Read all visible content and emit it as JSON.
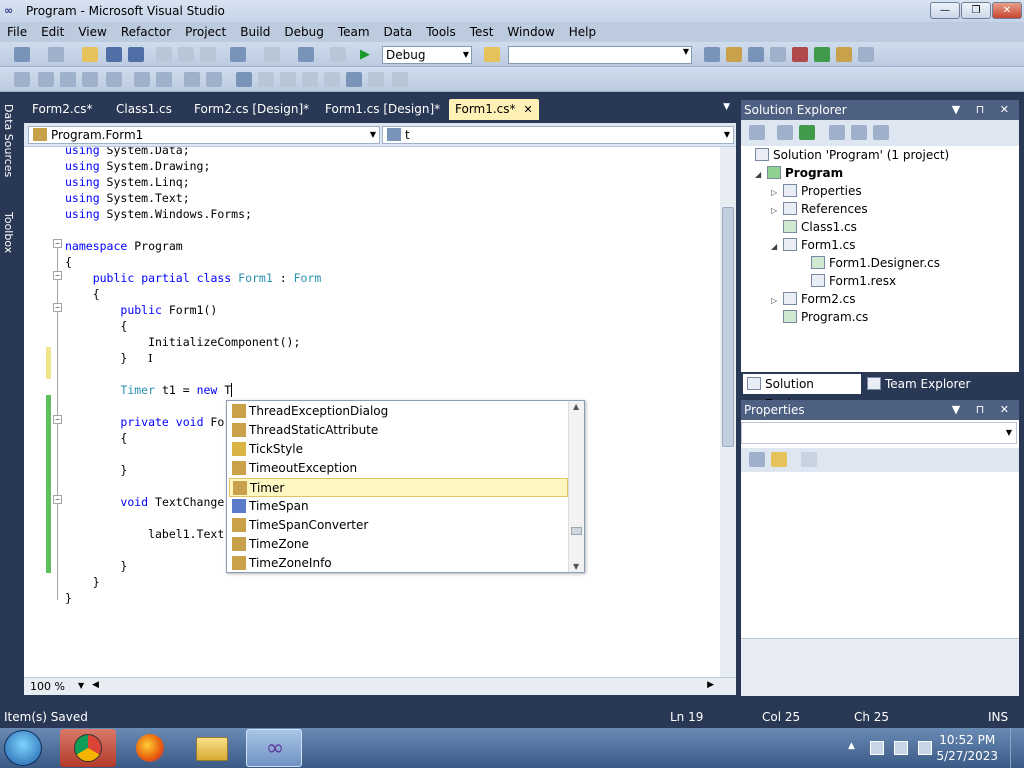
{
  "window": {
    "title": "Program - Microsoft Visual Studio",
    "min": "0",
    "max": "1",
    "close": "r"
  },
  "menu": [
    "File",
    "Edit",
    "View",
    "Refactor",
    "Project",
    "Build",
    "Debug",
    "Team",
    "Data",
    "Tools",
    "Test",
    "Window",
    "Help"
  ],
  "toolbar": {
    "configuration": "Debug",
    "platform": ""
  },
  "side_tabs": [
    "Data Sources",
    "Toolbox"
  ],
  "doc_tabs": [
    {
      "label": "Form2.cs*"
    },
    {
      "label": "Class1.cs"
    },
    {
      "label": "Form2.cs [Design]*"
    },
    {
      "label": "Form1.cs [Design]*"
    },
    {
      "label": "Form1.cs*",
      "active": true
    }
  ],
  "nav": {
    "type_selector": "Program.Form1",
    "member_selector": "t"
  },
  "code": {
    "lines": [
      "using System.Data;",
      "using System.Drawing;",
      "using System.Linq;",
      "using System.Text;",
      "using System.Windows.Forms;",
      "",
      "namespace Program",
      "{",
      "    public partial class Form1 : Form",
      "    {",
      "        public Form1()",
      "        {",
      "            InitializeComponent();",
      "        }",
      "",
      "        Timer t1 = new T",
      "",
      "        private void Fo",
      "        {",
      "",
      "        }",
      "",
      "        void TextChange",
      "",
      "            label1.Text",
      "",
      "        }",
      "    }",
      "}"
    ]
  },
  "intellisense": {
    "items": [
      "ThreadExceptionDialog",
      "ThreadStaticAttribute",
      "TickStyle",
      "TimeoutException",
      "Timer",
      "TimeSpan",
      "TimeSpanConverter",
      "TimeZone",
      "TimeZoneInfo"
    ],
    "selected": "Timer"
  },
  "zoom": "100 %",
  "solution_explorer": {
    "title": "Solution Explorer",
    "tree": [
      {
        "label": "Solution 'Program' (1 project)",
        "indent": 0,
        "twisty": ""
      },
      {
        "label": "Program",
        "indent": 1,
        "twisty": "◢",
        "bold": true
      },
      {
        "label": "Properties",
        "indent": 2,
        "twisty": "▷"
      },
      {
        "label": "References",
        "indent": 2,
        "twisty": "▷"
      },
      {
        "label": "Class1.cs",
        "indent": 2,
        "twisty": ""
      },
      {
        "label": "Form1.cs",
        "indent": 2,
        "twisty": "◢"
      },
      {
        "label": "Form1.Designer.cs",
        "indent": 3,
        "twisty": ""
      },
      {
        "label": "Form1.resx",
        "indent": 3,
        "twisty": ""
      },
      {
        "label": "Form2.cs",
        "indent": 2,
        "twisty": "▷"
      },
      {
        "label": "Program.cs",
        "indent": 2,
        "twisty": ""
      }
    ],
    "tabs": [
      "Solution Explorer",
      "Team Explorer"
    ]
  },
  "properties": {
    "title": "Properties"
  },
  "status": {
    "message": "Item(s) Saved",
    "ln": "Ln 19",
    "col": "Col 25",
    "ch": "Ch 25",
    "mode": "INS"
  },
  "taskbar": {
    "time": "10:52 PM",
    "date": "5/27/2023"
  },
  "colors": {
    "keyword": "#0000ff",
    "type": "#2b91af",
    "chrome": "#293955",
    "active_tab": "#fff1b6"
  }
}
